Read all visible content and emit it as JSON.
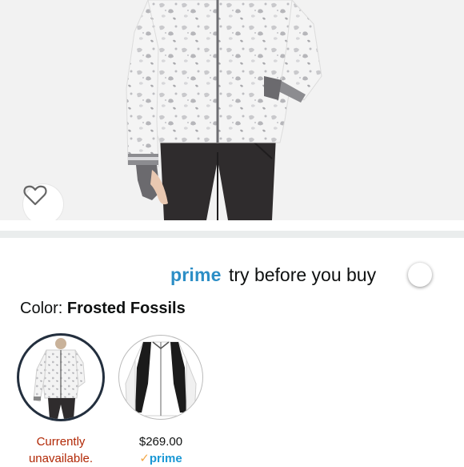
{
  "product": {
    "image_alt": "white ski jacket with frosted fossil print",
    "wishlist_icon": "heart-outline-icon"
  },
  "prime_try": {
    "prime_word": "prime",
    "tagline": "try before you buy",
    "toggle_state": "off"
  },
  "color": {
    "label": "Color:",
    "selected": "Frosted Fossils"
  },
  "swatches": [
    {
      "name": "Frosted Fossils",
      "caption_line1": "Currently",
      "caption_line2": "unavailable.",
      "selected": true
    },
    {
      "name": "White/Black",
      "price": "$269.00",
      "prime_check": "✓",
      "prime_label": "prime",
      "selected": false
    }
  ],
  "colors": {
    "prime_blue": "#2c8ec6",
    "unavailable_red": "#b12704",
    "selected_ring": "#232f3e"
  }
}
